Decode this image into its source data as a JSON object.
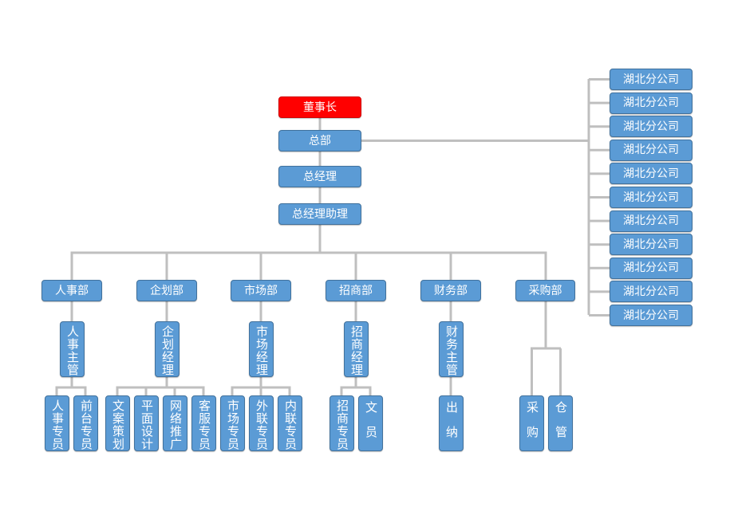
{
  "chart": {
    "colors": {
      "node_fill": "#5b9bd5",
      "node_border": "#41719c",
      "chairman_fill": "#ff0000",
      "connector": "#bfbfbf",
      "text": "#ffffff"
    },
    "top_chain": [
      {
        "id": "chairman",
        "label": "董事长"
      },
      {
        "id": "headquarters",
        "label": "总部"
      },
      {
        "id": "general-manager",
        "label": "总经理"
      },
      {
        "id": "gm-assistant",
        "label": "总经理助理"
      }
    ],
    "branches": [
      "湖北分公司",
      "湖北分公司",
      "湖北分公司",
      "湖北分公司",
      "湖北分公司",
      "湖北分公司",
      "湖北分公司",
      "湖北分公司",
      "湖北分公司",
      "湖北分公司",
      "湖北分公司"
    ],
    "departments": [
      {
        "label": "人事部",
        "manager": "人事主管",
        "staff": [
          "人事专员",
          "前台专员"
        ]
      },
      {
        "label": "企划部",
        "manager": "企划经理",
        "staff": [
          "文案策划",
          "平面设计",
          "网络推广",
          "客服专员"
        ]
      },
      {
        "label": "市场部",
        "manager": "市场经理",
        "staff": [
          "市场专员",
          "外联专员",
          "内联专员"
        ]
      },
      {
        "label": "招商部",
        "manager": "招商经理",
        "staff": [
          "招商专员",
          "文员"
        ]
      },
      {
        "label": "财务部",
        "manager": "财务主管",
        "staff": [
          "出纳"
        ]
      },
      {
        "label": "采购部",
        "manager": null,
        "staff": [
          "采购",
          "仓管"
        ]
      }
    ]
  }
}
